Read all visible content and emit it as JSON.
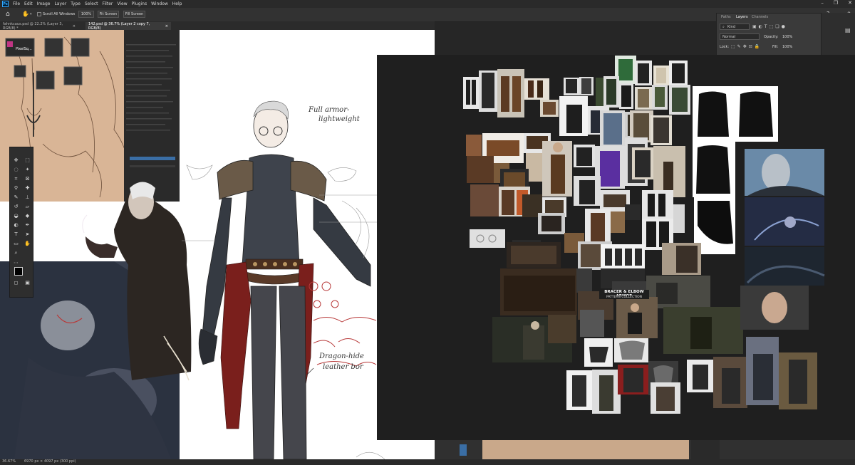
{
  "menubar": {
    "app_icon": "Ps",
    "items": [
      "File",
      "Edit",
      "Image",
      "Layer",
      "Type",
      "Select",
      "Filter",
      "View",
      "Plugins",
      "Window",
      "Help"
    ],
    "window_controls": [
      "–",
      "❐",
      "✕"
    ]
  },
  "optionsbar": {
    "scroll_all_windows": "Scroll All Windows",
    "zoom_100": "100%",
    "fit_screen": "Fit Screen",
    "fill_screen": "Fill Screen"
  },
  "tabs": [
    {
      "label": "fahnkcaus.psd @ 22.2% (Layer 3, RGB/8) *"
    },
    {
      "label": "142.psd @ 36.7% (Layer 2 copy 7, RGB/8)"
    }
  ],
  "layers_panel": {
    "tabs": [
      "Paths",
      "Layers",
      "Channels"
    ],
    "kind_label": "Kind",
    "blend_mode": "Normal",
    "opacity_label": "Opacity:",
    "opacity_value": "100%",
    "lock_label": "Lock:",
    "fill_label": "Fill:",
    "fill_value": "100%"
  },
  "pixel_app_label": "PixelSq...",
  "sketch_notes": {
    "note1": "Full armor-",
    "note2": "lightweight",
    "note3": "Dragon-hide",
    "note4": "leather bor"
  },
  "ref_text": {
    "bracer_title": "BRACER & ELBOW ARMOR",
    "bracer_sub": "PATTERN COLLECTION"
  },
  "statusbar": {
    "zoom": "36.67%",
    "doc_size": "6970 px × 4097 px (300 ppi)"
  },
  "colors": {
    "ui_dark": "#262626",
    "ref_board": "#1f1f1f",
    "sash_red": "#7a1f1c",
    "armor": "#3e434c",
    "sketch_bg": "#d9b596",
    "accent_blue": "#31a8ff"
  }
}
